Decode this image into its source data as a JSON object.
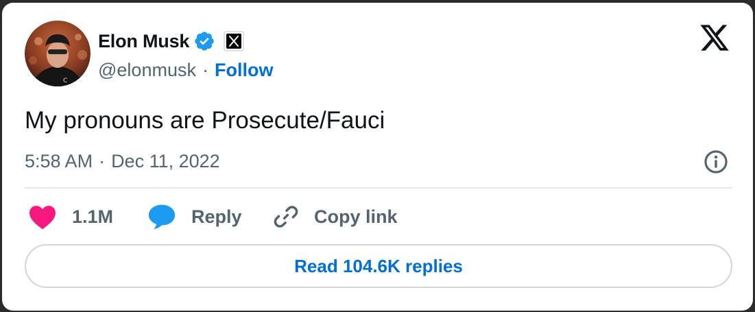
{
  "author": {
    "name": "Elon Musk",
    "handle": "@elonmusk",
    "separator": "·",
    "follow_label": "Follow",
    "verified_icon": "verified-badge-icon",
    "affiliation_icon": "x-affiliate-badge-icon"
  },
  "tweet": {
    "text": "My pronouns are Prosecute/Fauci",
    "time": "5:58 AM",
    "separator": "·",
    "date": "Dec 11, 2022"
  },
  "actions": {
    "like_count": "1.1M",
    "reply_label": "Reply",
    "copy_label": "Copy link"
  },
  "read_replies_label": "Read 104.6K replies",
  "colors": {
    "like": "#f91880",
    "reply": "#1d9bf0",
    "link_blue": "#006fd6",
    "muted": "#536471",
    "verified": "#1d9bf0"
  }
}
